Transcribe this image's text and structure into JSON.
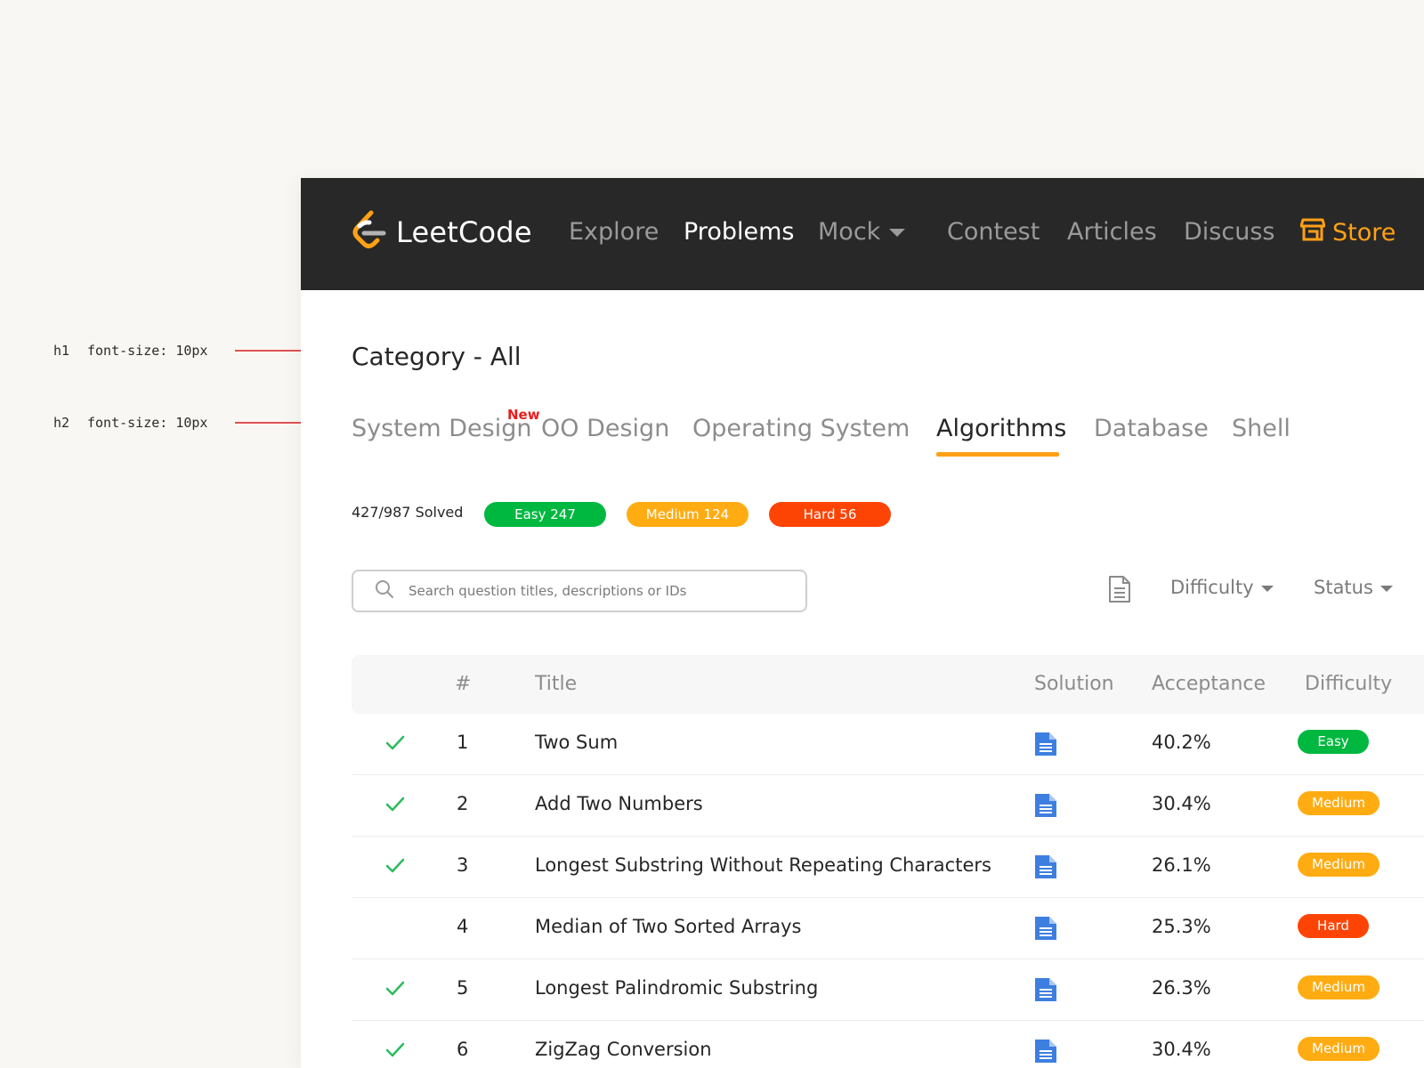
{
  "annotations": [
    {
      "tag": "h1",
      "text": "font-size: 10px"
    },
    {
      "tag": "h2",
      "text": "font-size: 10px"
    }
  ],
  "navbar": {
    "brand": "LeetCode",
    "items": [
      "Explore",
      "Problems",
      "Mock",
      "Contest",
      "Articles",
      "Discuss"
    ],
    "active": "Problems",
    "store": "Store",
    "accent": "#ffa116",
    "background": "#282828"
  },
  "page": {
    "title": "Category - All",
    "tabs": [
      "System Design",
      "OO Design",
      "Operating System",
      "Algorithms",
      "Database",
      "Shell"
    ],
    "active_tab": "Algorithms",
    "new_badge": "New"
  },
  "stats": {
    "solved": "427/987",
    "solved_label": "Solved",
    "easy": "Easy 247",
    "medium": "Medium 124",
    "hard": "Hard 56"
  },
  "search": {
    "value": "",
    "placeholder": "Search question titles, descriptions or IDs"
  },
  "filters": {
    "difficulty": "Difficulty",
    "status": "Status"
  },
  "table": {
    "headers": {
      "number": "#",
      "title": "Title",
      "solution": "Solution",
      "acceptance": "Acceptance",
      "difficulty": "Difficulty"
    },
    "rows": [
      {
        "solved": true,
        "id": "1",
        "title": "Two Sum",
        "acceptance": "40.2%",
        "difficulty": "Easy"
      },
      {
        "solved": true,
        "id": "2",
        "title": "Add Two Numbers",
        "acceptance": "30.4%",
        "difficulty": "Medium"
      },
      {
        "solved": true,
        "id": "3",
        "title": "Longest Substring Without Repeating Characters",
        "acceptance": "26.1%",
        "difficulty": "Medium"
      },
      {
        "solved": false,
        "id": "4",
        "title": "Median of Two Sorted Arrays",
        "acceptance": "25.3%",
        "difficulty": "Hard"
      },
      {
        "solved": true,
        "id": "5",
        "title": "Longest Palindromic Substring",
        "acceptance": "26.3%",
        "difficulty": "Medium"
      },
      {
        "solved": true,
        "id": "6",
        "title": "ZigZag Conversion",
        "acceptance": "30.4%",
        "difficulty": "Medium"
      }
    ]
  },
  "colors": {
    "easy": "#00b840",
    "medium": "#ffac13",
    "hard": "#fe4405",
    "check": "#2cbb5d",
    "solution_icon": "#3d7fe0"
  },
  "icons": {
    "check": "check-icon",
    "solution": "document-icon",
    "search": "search-icon",
    "store": "store-icon"
  }
}
